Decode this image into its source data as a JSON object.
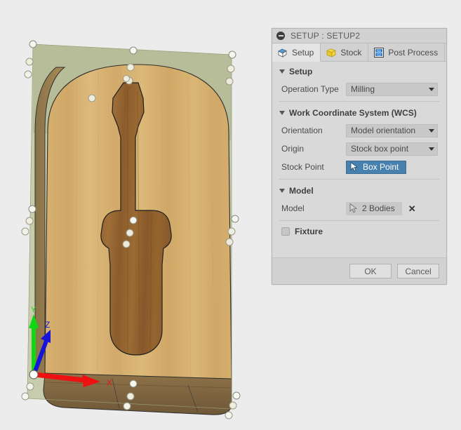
{
  "panel": {
    "titlebar": {
      "collapse_icon": "minus-circle-icon",
      "title": "SETUP : SETUP2"
    },
    "tabs": [
      {
        "label": "Setup",
        "icon": "setup-cube-icon",
        "active": true
      },
      {
        "label": "Stock",
        "icon": "stock-cube-icon",
        "active": false
      },
      {
        "label": "Post Process",
        "icon": "g-code-icon",
        "active": false
      }
    ],
    "sections": [
      {
        "name": "setup",
        "header": "Setup",
        "rows": [
          {
            "label": "Operation Type",
            "value": "Milling",
            "control": "dropdown"
          }
        ]
      },
      {
        "name": "wcs",
        "header": "Work Coordinate System (WCS)",
        "rows": [
          {
            "label": "Orientation",
            "value": "Model orientation",
            "control": "dropdown"
          },
          {
            "label": "Origin",
            "value": "Stock box point",
            "control": "dropdown"
          },
          {
            "label": "Stock Point",
            "value": "Box Point",
            "control": "blue-button",
            "icon": "cursor-arrow-icon"
          }
        ]
      },
      {
        "name": "model",
        "header": "Model",
        "rows": [
          {
            "label": "Model",
            "value": "2 Bodies",
            "control": "selection-button",
            "icon": "cursor-arrow-icon",
            "clear": "✕"
          }
        ]
      }
    ],
    "fixture": {
      "label": "Fixture",
      "checked": false
    },
    "footer": {
      "ok_label": "OK",
      "cancel_label": "Cancel"
    }
  },
  "viewport": {
    "axes": [
      {
        "name": "X",
        "label": "X",
        "color": "#ee1111"
      },
      {
        "name": "Y",
        "label": "Y",
        "color": "#10d810"
      },
      {
        "name": "Z",
        "label": "Z",
        "color": "#1414dd"
      }
    ],
    "model_description": "wooden board with screwdriver pocket",
    "stock_box_label": "stock-box-overlay",
    "colors": {
      "background": "#ececec",
      "wood_light": "#d4af6c",
      "wood_dark": "#8a5a2b",
      "stock_overlay": "#b2b98a",
      "handle_fill": "#ffffff"
    }
  }
}
